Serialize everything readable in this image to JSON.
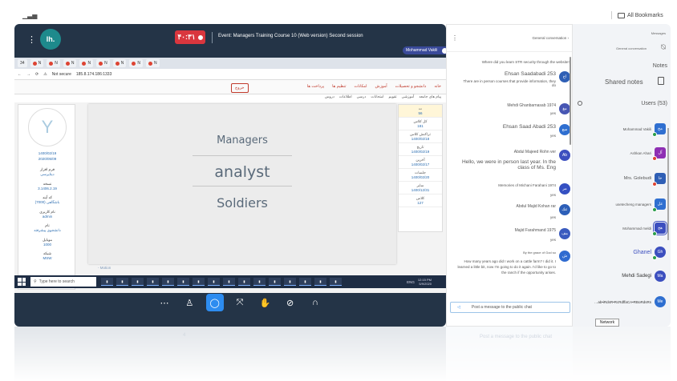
{
  "top": {
    "bookmarks_label": "All Bookmarks"
  },
  "meeting": {
    "timer": "۴۰:۳۱",
    "event_title": "Event: Managers Training Course 10 (Web version) Second session",
    "user_chip": "Mohammad Vakili",
    "logo_text": "lh."
  },
  "share": {
    "tab_count": "34",
    "address_prefix": "Not secure",
    "address": "185.8.174.186:1333",
    "nav_button": "خروج",
    "nav_items": [
      "خانه",
      "دانشجو و تحصیلات",
      "آموزش",
      "امکانات",
      "تنظیم ها",
      "پرداخت ها"
    ],
    "sub_nav": [
      "دروس",
      "اطلاعات",
      "درسی",
      "امتحانات",
      "تقویم",
      "آموزشی",
      "پیام های جامعه"
    ],
    "dates": [
      "1400/02/19",
      "2020/05/09"
    ],
    "info_rows": [
      {
        "label": "فرم افزار",
        "value": "دیتاپرسی"
      },
      {
        "label": "نسخه",
        "value": "3.1406.2.19"
      },
      {
        "label": "کد آیند",
        "value": "(7000) ‎باشگاهی"
      },
      {
        "label": "نام کاربری",
        "value": "admin"
      },
      {
        "label": "نام",
        "value": "دانشجوی پیشرفته"
      },
      {
        "label": "موبایل",
        "value": "1000"
      },
      {
        "label": "شبکه",
        "value": "MSW"
      }
    ],
    "right_list": [
      {
        "label": "ت",
        "value": "56"
      },
      {
        "label": "کل کلاس",
        "value": "181"
      },
      {
        "label": "تراکنش کلاس",
        "value": "1400/02/18"
      },
      {
        "label": "تاریخ",
        "value": "1400/02/19"
      },
      {
        "label": "آخرین",
        "value": "1400/02/17"
      },
      {
        "label": "جلسات",
        "value": "1400/02/20"
      },
      {
        "label": "سایر",
        "value": "1400/12/31"
      },
      {
        "label": "کلاس",
        "value": "127"
      }
    ],
    "motion_label": "- Motion",
    "slide_lines": [
      "Managers",
      "analyst",
      "Soldiers"
    ],
    "taskbar": {
      "search_placeholder": "Type here to search",
      "tray_lang": "ENG",
      "time": "12:15 PM",
      "date": "5/9/2020"
    }
  },
  "controls": [
    "more",
    "users",
    "chat",
    "fullscreen",
    "raise-hand",
    "camera-off",
    "headset"
  ],
  "chat": {
    "header": "General conversation",
    "messages": [
      {
        "text": "Where did you learn STR security through the website?",
        "small": true
      },
      {
        "name": "Ehsan Saadabadi 253",
        "text": "There are in person courses that provide information, they do",
        "avatar": "اح",
        "color": "#2f5fb5"
      },
      {
        "name": "Mehdi Ghanbarnasab 1974",
        "text": "yes",
        "avatar": "مغ",
        "color": "#4756b3"
      },
      {
        "name": "Ehsan Saad Abadi 253",
        "text": "yes",
        "avatar": "سع",
        "color": "#2f6fd0"
      },
      {
        "name": "Abdul Majeed Rohn ver",
        "text": "Hello, we were in person last year. In the class of Ms. Eng",
        "avatar": "Ab",
        "color": "#3c4fbf"
      },
      {
        "name": "Memories of Michani Farahani 1974",
        "text": "yes",
        "avatar": "مر",
        "color": "#3550c2"
      },
      {
        "name": "Abdul Majid Kohan rar",
        "text": "yes",
        "avatar": "عك",
        "color": "#2d5fb8"
      },
      {
        "name": "Majid Farahmand 1975",
        "text": "yes",
        "avatar": "مف",
        "color": "#3a5bbf"
      },
      {
        "name": "By the grace of God so",
        "text": "How many years ago did I work on a cattle farm? I did it. I learned a little bit, now I'm going to do it again. I'd like to go to the ranch if the opportunity arises.",
        "avatar": "ش",
        "color": "#2f6bd0"
      }
    ],
    "input_placeholder": "Post a message to the public chat"
  },
  "users": {
    "top_label": "Messages",
    "top_row": "General conversation",
    "notes_label": "Notes",
    "shared_notes": "Shared notes",
    "title": "Users (53)",
    "list": [
      {
        "name": "Mohammad Vakili",
        "initials": "مح",
        "color": "#2f6fd0",
        "badge": "#2a9d4a"
      },
      {
        "name": "Ashkan Ahari",
        "initials": "آل",
        "color": "#8e2fb3",
        "badge": "#d43"
      },
      {
        "name": "Mrs. Golebudi",
        "initials": "خا",
        "color": "#2f5fb5",
        "badge": "#d43"
      },
      {
        "name": "usetecheng managers",
        "initials": "عل",
        "color": "#2f6fd0",
        "badge": "#2a9d4a"
      },
      {
        "name": "Mohammad meldi",
        "initials": "هح",
        "color": "#3c4fbf",
        "badge": "#2a9d4a"
      },
      {
        "name": "Ghanel",
        "initials": "Gh",
        "color": "#3c4fbf",
        "badge": "#2a9d4a"
      },
      {
        "name": "Mehdi Sadegi",
        "initials": "Ma",
        "color": "#3c4fbf",
        "badge": ""
      },
      {
        "name": "…ab•iRdsR•RcRdffaCA•RBoRdsRs",
        "initials": "Me",
        "color": "#2f6fd0",
        "badge": ""
      }
    ],
    "network_label": "Network"
  },
  "reflection": {
    "chat_text": "Post a message to the public chat",
    "count": "4"
  }
}
